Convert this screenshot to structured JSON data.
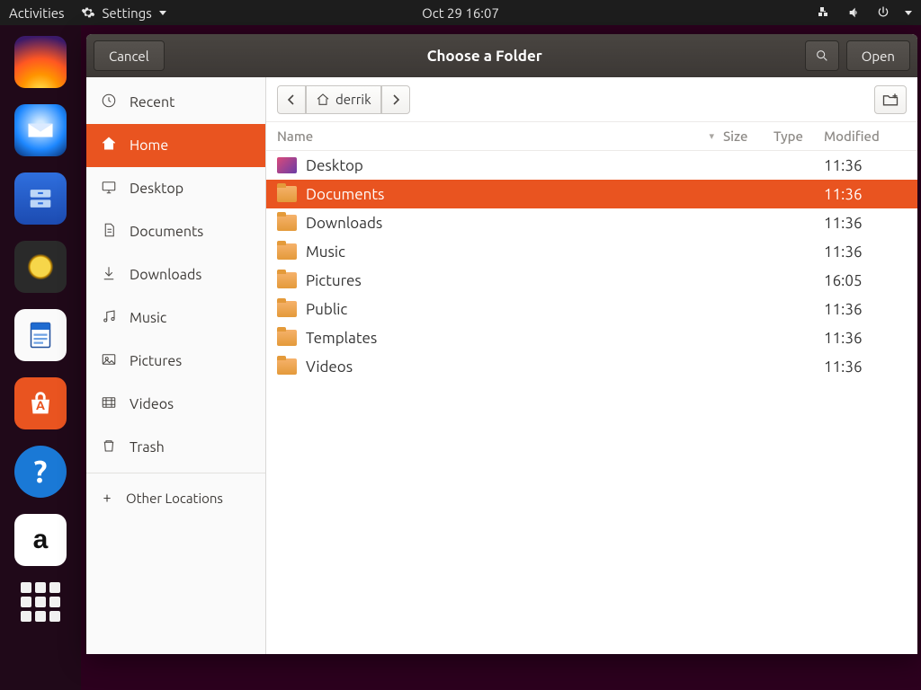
{
  "panel": {
    "activities": "Activities",
    "appmenu": "Settings",
    "clock": "Oct 29  16:07"
  },
  "titlebar": {
    "cancel": "Cancel",
    "title": "Choose a Folder",
    "open": "Open"
  },
  "sidebar": {
    "places": [
      {
        "key": "recent",
        "label": "Recent",
        "icon": "clock"
      },
      {
        "key": "home",
        "label": "Home",
        "icon": "home",
        "selected": true
      },
      {
        "key": "desktop",
        "label": "Desktop",
        "icon": "desktop"
      },
      {
        "key": "documents",
        "label": "Documents",
        "icon": "doc"
      },
      {
        "key": "downloads",
        "label": "Downloads",
        "icon": "download"
      },
      {
        "key": "music",
        "label": "Music",
        "icon": "music"
      },
      {
        "key": "pictures",
        "label": "Pictures",
        "icon": "picture"
      },
      {
        "key": "videos",
        "label": "Videos",
        "icon": "video"
      },
      {
        "key": "trash",
        "label": "Trash",
        "icon": "trash"
      }
    ],
    "other": "Other Locations"
  },
  "path": {
    "segments": [
      "derrik"
    ]
  },
  "columns": {
    "name": "Name",
    "size": "Size",
    "type": "Type",
    "modified": "Modified"
  },
  "files": [
    {
      "name": "Desktop",
      "modified": "11:36",
      "selected": false,
      "icon": "desktop"
    },
    {
      "name": "Documents",
      "modified": "11:36",
      "selected": true,
      "icon": "folder"
    },
    {
      "name": "Downloads",
      "modified": "11:36",
      "selected": false,
      "icon": "folder"
    },
    {
      "name": "Music",
      "modified": "11:36",
      "selected": false,
      "icon": "folder"
    },
    {
      "name": "Pictures",
      "modified": "16:05",
      "selected": false,
      "icon": "folder"
    },
    {
      "name": "Public",
      "modified": "11:36",
      "selected": false,
      "icon": "folder"
    },
    {
      "name": "Templates",
      "modified": "11:36",
      "selected": false,
      "icon": "folder"
    },
    {
      "name": "Videos",
      "modified": "11:36",
      "selected": false,
      "icon": "folder"
    }
  ],
  "dock": [
    "firefox",
    "thunderbird",
    "files",
    "rhythmbox",
    "writer",
    "software",
    "help",
    "amazon",
    "apps"
  ]
}
